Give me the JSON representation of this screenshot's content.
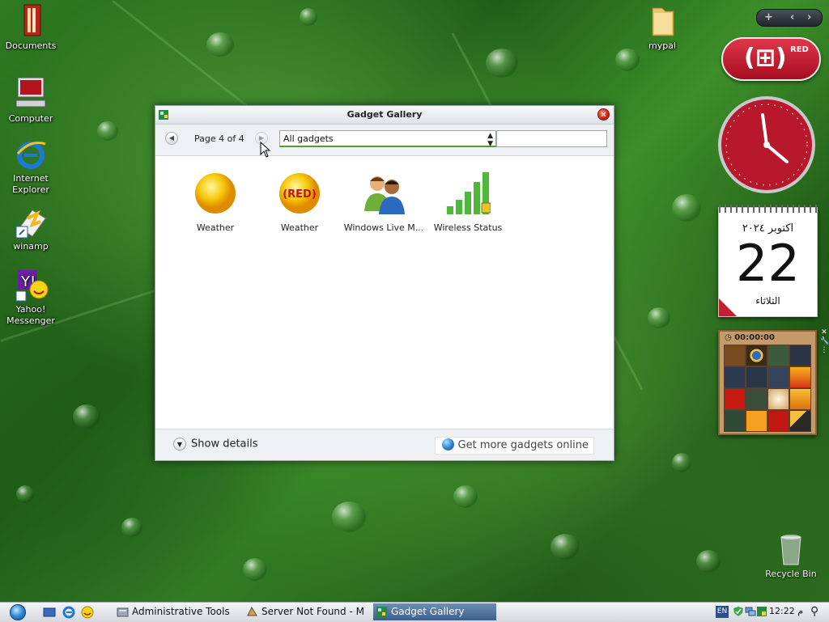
{
  "desktop": {
    "icons": [
      {
        "label": "Documents"
      },
      {
        "label": "Computer"
      },
      {
        "label": "Internet Explorer"
      },
      {
        "label": "winamp"
      },
      {
        "label": "Yahoo! Messenger"
      },
      {
        "label": "mypal"
      },
      {
        "label": "Recycle Bin"
      }
    ]
  },
  "gallery": {
    "title": "Gadget Gallery",
    "page_info": "Page 4 of 4",
    "filter_value": "All gadgets",
    "search_value": "",
    "items": [
      {
        "label": "Weather",
        "icon": "sun-icon"
      },
      {
        "label": "Weather",
        "icon": "red-sun-icon"
      },
      {
        "label": "Windows Live M...",
        "icon": "people-icon"
      },
      {
        "label": "Wireless Status",
        "icon": "signal-bars-icon"
      }
    ],
    "show_details": "Show details",
    "get_more": "Get more gadgets online"
  },
  "sidebar": {
    "red_label": "RED",
    "calendar": {
      "month": "اكتوبر ٢٠٢٤",
      "day": "22",
      "weekday": "الثلاثاء"
    },
    "puzzle_timer": "00:00:00"
  },
  "taskbar": {
    "tasks": [
      {
        "label": "Administrative Tools"
      },
      {
        "label": "Server Not Found - M..."
      },
      {
        "label": "Gadget Gallery"
      }
    ],
    "language": "EN",
    "time": "12:22 م"
  },
  "colors": {
    "accent": "#3b5f8e",
    "red": "#c42030",
    "green": "#5a9c2a"
  }
}
